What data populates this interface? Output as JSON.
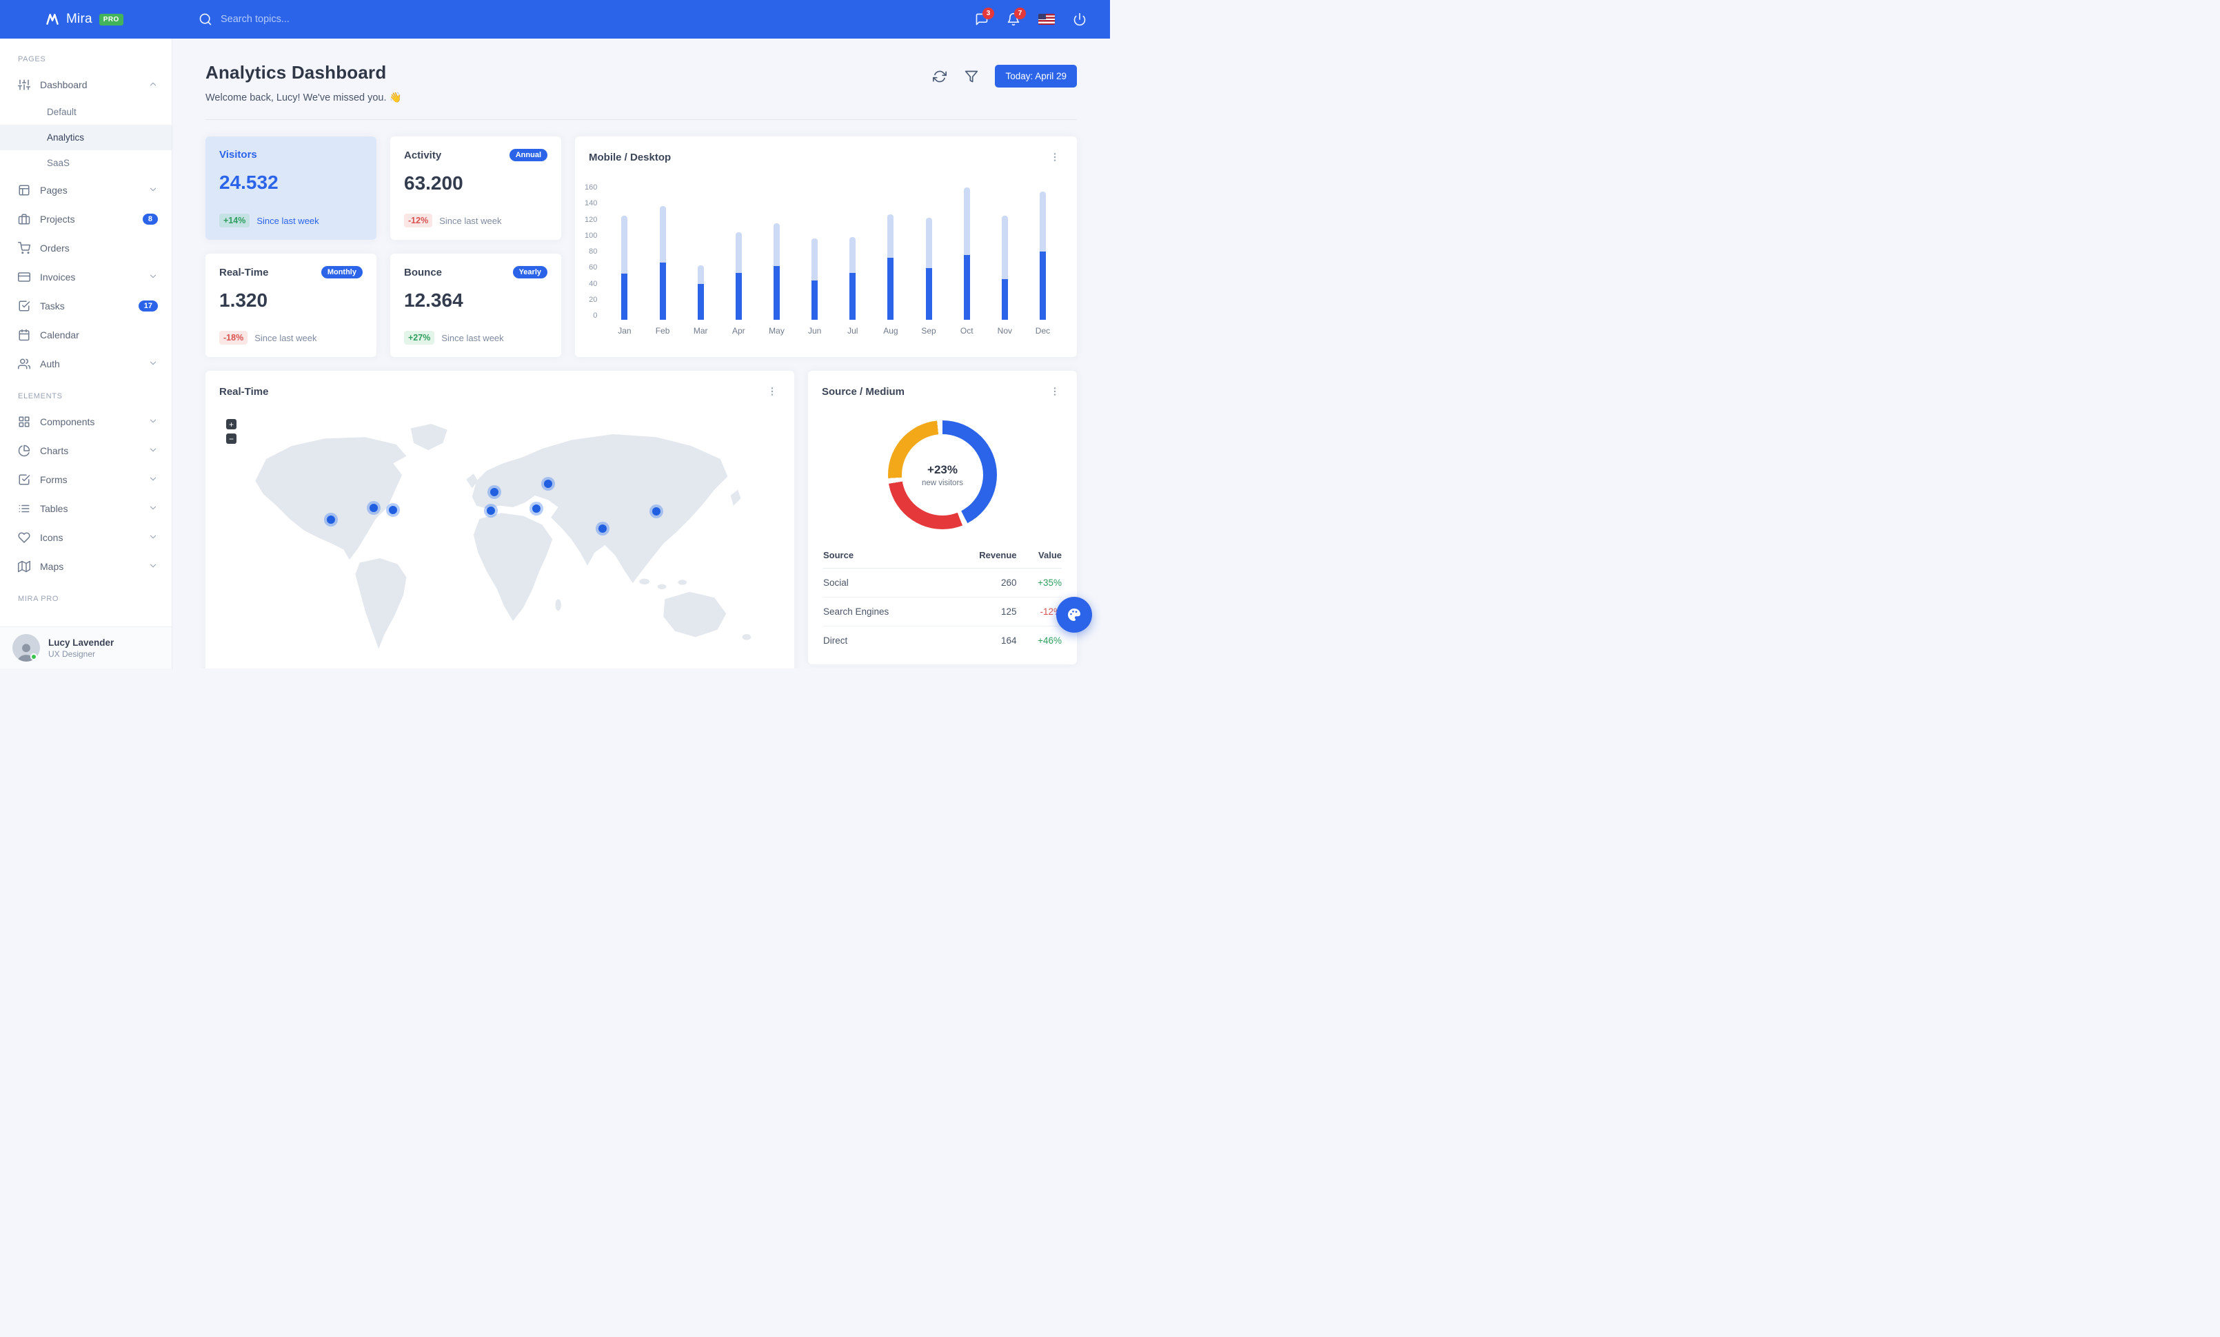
{
  "navbar": {
    "brand": "Mira",
    "brand_badge": "PRO",
    "search_placeholder": "Search topics...",
    "messages_badge": "3",
    "notifications_badge": "7"
  },
  "sidebar": {
    "section_pages": "PAGES",
    "section_elements": "ELEMENTS",
    "section_pro": "MIRA PRO",
    "dashboard": {
      "label": "Dashboard",
      "children": [
        {
          "label": "Default"
        },
        {
          "label": "Analytics"
        },
        {
          "label": "SaaS"
        }
      ]
    },
    "items_pages": [
      {
        "label": "Pages"
      },
      {
        "label": "Projects",
        "badge": "8"
      },
      {
        "label": "Orders"
      },
      {
        "label": "Invoices"
      },
      {
        "label": "Tasks",
        "badge": "17"
      },
      {
        "label": "Calendar"
      },
      {
        "label": "Auth"
      }
    ],
    "items_elements": [
      {
        "label": "Components"
      },
      {
        "label": "Charts"
      },
      {
        "label": "Forms"
      },
      {
        "label": "Tables"
      },
      {
        "label": "Icons"
      },
      {
        "label": "Maps"
      }
    ],
    "user": {
      "name": "Lucy Lavender",
      "role": "UX Designer"
    }
  },
  "header": {
    "title": "Analytics Dashboard",
    "subtitle": "Welcome back, Lucy! We've missed you. 👋",
    "date_button": "Today: April 29"
  },
  "stats": [
    {
      "title": "Visitors",
      "value": "24.532",
      "change": "+14%",
      "note": "Since last week"
    },
    {
      "title": "Activity",
      "badge": "Annual",
      "value": "63.200",
      "change": "-12%",
      "note": "Since last week"
    },
    {
      "title": "Real-Time",
      "badge": "Monthly",
      "value": "1.320",
      "change": "-18%",
      "note": "Since last week"
    },
    {
      "title": "Bounce",
      "badge": "Yearly",
      "value": "12.364",
      "change": "+27%",
      "note": "Since last week"
    }
  ],
  "realtime_map": {
    "title": "Real-Time",
    "zoom_in": "+",
    "zoom_out": "−",
    "markers": [
      {
        "x": 159,
        "y": 151
      },
      {
        "x": 217,
        "y": 135
      },
      {
        "x": 244,
        "y": 138
      },
      {
        "x": 378,
        "y": 139
      },
      {
        "x": 382,
        "y": 113
      },
      {
        "x": 440,
        "y": 136
      },
      {
        "x": 456,
        "y": 102
      },
      {
        "x": 531,
        "y": 163
      },
      {
        "x": 604,
        "y": 140
      }
    ]
  },
  "source_medium": {
    "title": "Source / Medium",
    "table": {
      "headers": [
        "Source",
        "Revenue",
        "Value"
      ],
      "rows": [
        {
          "source": "Social",
          "revenue": "260",
          "value": "+35%"
        },
        {
          "source": "Search Engines",
          "revenue": "125",
          "value": "-12%"
        },
        {
          "source": "Direct",
          "revenue": "164",
          "value": "+46%"
        }
      ]
    }
  },
  "chart_data": [
    {
      "type": "bar",
      "title": "Mobile / Desktop",
      "stacked": true,
      "categories": [
        "Jan",
        "Feb",
        "Mar",
        "Apr",
        "May",
        "Jun",
        "Jul",
        "Aug",
        "Sep",
        "Oct",
        "Nov",
        "Dec"
      ],
      "series": [
        {
          "name": "Mobile",
          "color": "#2b64e9",
          "values": [
            54,
            67,
            42,
            55,
            63,
            46,
            55,
            73,
            61,
            76,
            48,
            80
          ]
        },
        {
          "name": "Desktop",
          "color": "#ccdaf5",
          "values": [
            68,
            66,
            22,
            48,
            50,
            49,
            42,
            51,
            59,
            79,
            74,
            70
          ]
        }
      ],
      "ylim": [
        0,
        160
      ],
      "yticks": [
        0,
        20,
        40,
        60,
        80,
        100,
        120,
        140,
        160
      ],
      "xlabel": "",
      "ylabel": "",
      "grid": false,
      "legend": false
    },
    {
      "type": "donut",
      "title": "Source / Medium",
      "center_label": "+23%",
      "center_sublabel": "new visitors",
      "segments": [
        {
          "value": 44,
          "color": "#2b64e9"
        },
        {
          "value": 30,
          "color": "#e5383b"
        },
        {
          "value": 26,
          "color": "#f2a819"
        }
      ]
    }
  ],
  "colors": {
    "primary": "#2b64e9",
    "success": "#4bbf73",
    "danger": "#d9534f",
    "highlight_card": "#dce7fa"
  }
}
